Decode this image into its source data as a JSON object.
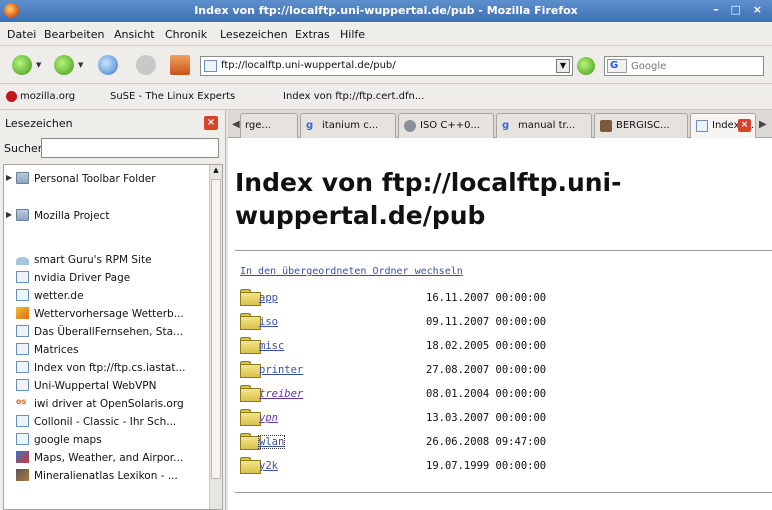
{
  "window": {
    "title": "Index von ftp://localftp.uni-wuppertal.de/pub - Mozilla Firefox",
    "controls": "– □ ×"
  },
  "menu": [
    "Datei",
    "Bearbeiten",
    "Ansicht",
    "Chronik",
    "Lesezeichen",
    "Extras",
    "Hilfe"
  ],
  "nav": {
    "url": "ftp://localftp.uni-wuppertal.de/pub/",
    "search_engine": "G",
    "search_placeholder": "Google",
    "icons": [
      "back-arrow-icon",
      "forward-arrow-icon",
      "reload-icon",
      "stop-icon",
      "home-icon",
      "go-arrow-icon"
    ]
  },
  "bookmarks_bar": [
    "mozilla.org",
    "SuSE - The Linux Experts",
    "Index von ftp://ftp.cert.dfn..."
  ],
  "sidebar": {
    "title": "Lesezeichen",
    "search_label": "Suchen:",
    "search_value": "",
    "items": [
      {
        "label": "Personal Toolbar Folder",
        "type": "folder"
      },
      {
        "label": "Mozilla Project",
        "type": "folder"
      },
      {
        "label": "smart Guru's RPM Site",
        "type": "page"
      },
      {
        "label": "nvidia Driver Page",
        "type": "page"
      },
      {
        "label": "wetter.de",
        "type": "page"
      },
      {
        "label": "Wettervorhersage Wetterb...",
        "type": "page"
      },
      {
        "label": "Das ÜberallFernsehen, Sta...",
        "type": "page"
      },
      {
        "label": "Matrices",
        "type": "page"
      },
      {
        "label": "Index von ftp://ftp.cs.iastat...",
        "type": "page"
      },
      {
        "label": "Uni-Wuppertal WebVPN",
        "type": "page"
      },
      {
        "label": "iwi driver at OpenSolaris.org",
        "type": "page"
      },
      {
        "label": "Collonil - Classic - Ihr Sch...",
        "type": "page"
      },
      {
        "label": "google maps",
        "type": "page"
      },
      {
        "label": "Maps, Weather, and Airpor...",
        "type": "page"
      },
      {
        "label": "Mineralienatlas Lexikon - ...",
        "type": "page"
      }
    ]
  },
  "tabs": [
    {
      "label": "rge...",
      "active": false
    },
    {
      "label": "itanium c...",
      "active": false
    },
    {
      "label": "ISO C++0...",
      "active": false
    },
    {
      "label": "manual tr...",
      "active": false
    },
    {
      "label": "BERGISC...",
      "active": false
    },
    {
      "label": "Index v...",
      "active": true
    }
  ],
  "page": {
    "heading": "Index von ftp://localftp.uni-wuppertal.de/pub",
    "parent_link": "In den übergeordneten Ordner wechseln",
    "entries": [
      {
        "name": "app",
        "date": "16.11.2007 00:00:00",
        "visited": false
      },
      {
        "name": "iso",
        "date": "09.11.2007 00:00:00",
        "visited": false
      },
      {
        "name": "misc",
        "date": "18.02.2005 00:00:00",
        "visited": false
      },
      {
        "name": "printer",
        "date": "27.08.2007 00:00:00",
        "visited": false
      },
      {
        "name": "treiber",
        "date": "08.01.2004 00:00:00",
        "visited": true
      },
      {
        "name": "vpn",
        "date": "13.03.2007 00:00:00",
        "visited": true
      },
      {
        "name": "wlan",
        "date": "26.06.2008 09:47:00",
        "visited": false
      },
      {
        "name": "y2k",
        "date": "19.07.1999 00:00:00",
        "visited": false
      }
    ]
  }
}
